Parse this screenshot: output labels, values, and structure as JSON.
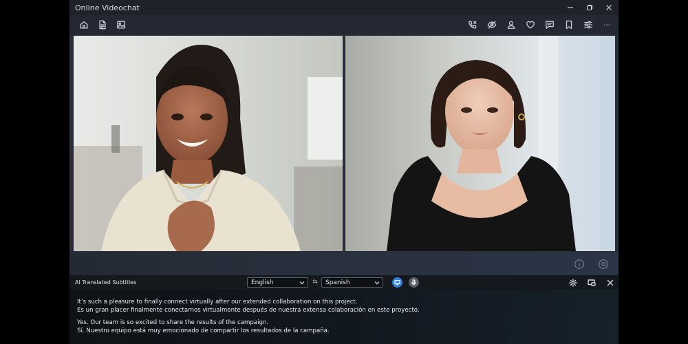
{
  "window": {
    "title": "Online Videochat"
  },
  "window_controls": [
    "minimize-icon",
    "restore-icon",
    "close-icon"
  ],
  "toolbar": {
    "left_icons": [
      "home-icon",
      "document-icon",
      "image-icon"
    ],
    "right_icons": [
      "phone-call-icon",
      "eye-off-icon",
      "person-icon",
      "heart-icon",
      "chat-icon",
      "bookmark-icon",
      "sliders-icon",
      "more-icon"
    ],
    "more_label": "···"
  },
  "participants": [
    {
      "name_visible": false,
      "tile": "left"
    },
    {
      "name_visible": false,
      "tile": "right"
    }
  ],
  "stage_controls": [
    "info-icon",
    "settings-circle-icon"
  ],
  "subtitles": {
    "label": "AI Translated Subtitles",
    "source_language": "English",
    "target_language": "Spanish",
    "swap_symbol": "⇆",
    "screen_button_color": "#2f7fe0",
    "mic_button_color": "#5a5f68",
    "header_icons": [
      "gear-icon",
      "screen-icon",
      "close-icon"
    ]
  },
  "transcript": [
    {
      "original": "It’s such a pleasure to finally connect virtually after our extended collaboration on this project.",
      "translation": "Es un gran placer finalmente conectarnos virtualmente después de nuestra extensa colaboración en este proyecto."
    },
    {
      "original": "Yes. Our team is so excited to share the results of the campaign.",
      "translation": "Sí. Nuestro equipo está muy emocionado de compartir los resultados de la campaña."
    }
  ],
  "colors": {
    "background": "#1b1f26",
    "accent": "#2f7fe0"
  }
}
